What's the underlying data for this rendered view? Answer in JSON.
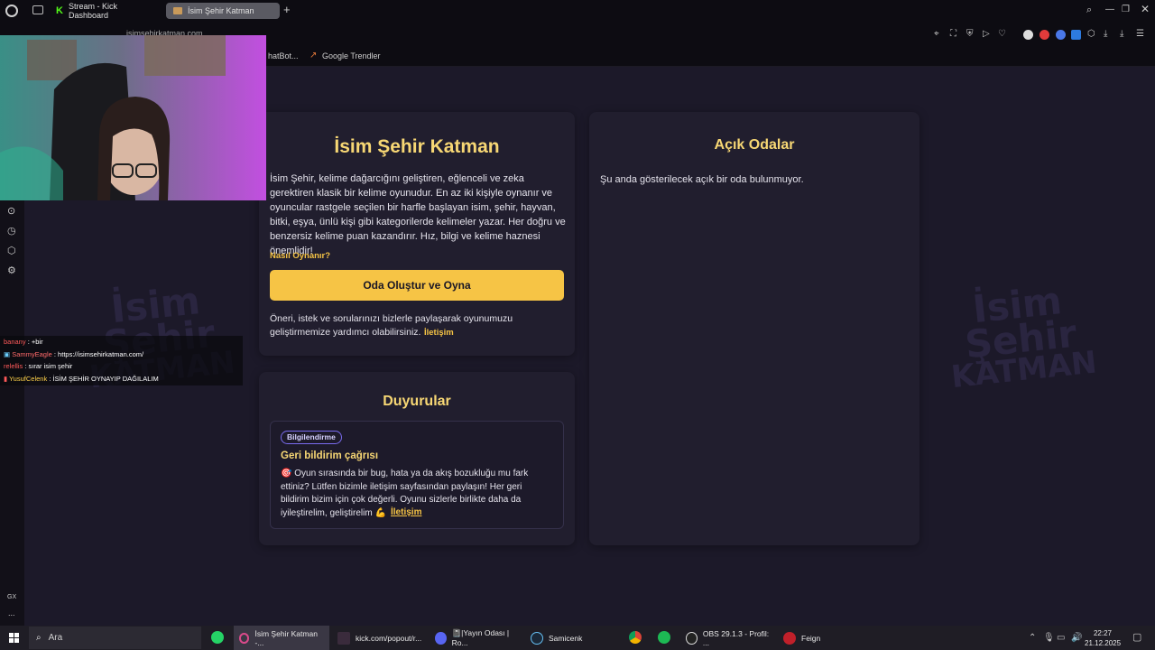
{
  "browser": {
    "tabs": [
      {
        "label": "Stream - Kick Dashboard"
      },
      {
        "label": "İsim Şehir Katman"
      }
    ],
    "url": "isimsehirkatman.com",
    "bookmarks": [
      {
        "label": "hatBot..."
      },
      {
        "label": "Google Trendler"
      }
    ]
  },
  "page": {
    "main_card": {
      "title": "İsim Şehir Katman",
      "description": "İsim Şehir, kelime dağarcığını geliştiren, eğlenceli ve zeka gerektiren klasik bir kelime oyunudur. En az iki kişiyle oynanır ve oyuncular rastgele seçilen bir harfle başlayan isim, şehir, hayvan, bitki, eşya, ünlü kişi gibi kategorilerde kelimeler yazar. Her doğru ve benzersiz kelime puan kazandırır. Hız, bilgi ve kelime haznesi önemlidir!",
      "how_to_play": "Nasıl Oynanır?",
      "create_button": "Oda Oluştur ve Oyna",
      "feedback_text": "Öneri, istek ve sorularınızı bizlerle paylaşarak oyunumuzu geliştirmemize yardımcı olabilirsiniz.",
      "contact_link": "İletişim"
    },
    "rooms_card": {
      "title": "Açık Odalar",
      "empty_text": "Şu anda gösterilecek açık bir oda bulunmuyor."
    },
    "announcements": {
      "title": "Duyurular",
      "item": {
        "badge": "Bilgilendirme",
        "heading": "Geri bildirim çağrısı",
        "body": "🎯 Oyun sırasında bir bug, hata ya da akış bozukluğu mu fark ettiniz? Lütfen bizimle iletişim sayfasından paylaşın! Her geri bildirim bizim için çok değerli. Oyunu sizlerle birlikte daha da iyileştirelim, geliştirelim 💪",
        "link": "İletişim"
      }
    },
    "watermark_text": [
      "İsim",
      "Şehir",
      "KATMAN"
    ]
  },
  "chat": {
    "messages": [
      {
        "user": "banany",
        "text": ": +bir"
      },
      {
        "user": "SammyEagle",
        "text": ": https://isimsehirkatman.com/"
      },
      {
        "user": "relellis",
        "text": ": sırar isim şehir"
      },
      {
        "user": "YusufCelenk",
        "text": ": İSİM ŞEHİR OYNAYIP DAĞILALIM"
      }
    ]
  },
  "sidepanel": {
    "gx_label": "GX",
    "more_label": "..."
  },
  "taskbar": {
    "search_placeholder": "Ara",
    "items": [
      {
        "label": "İsim Şehir Katman -..."
      },
      {
        "label": "kick.com/popout/r..."
      },
      {
        "label": "📓|Yayın Odası | Ro..."
      },
      {
        "label": "Samicenk"
      },
      {
        "label": "OBS 29.1.3 - Profil: ..."
      },
      {
        "label": "Feign"
      }
    ],
    "time": "22:27",
    "date": "21.12.2025"
  },
  "colors": {
    "accent": "#f6c445",
    "title": "#f7d774",
    "background": "#1c1929",
    "card": "#211e2e"
  }
}
